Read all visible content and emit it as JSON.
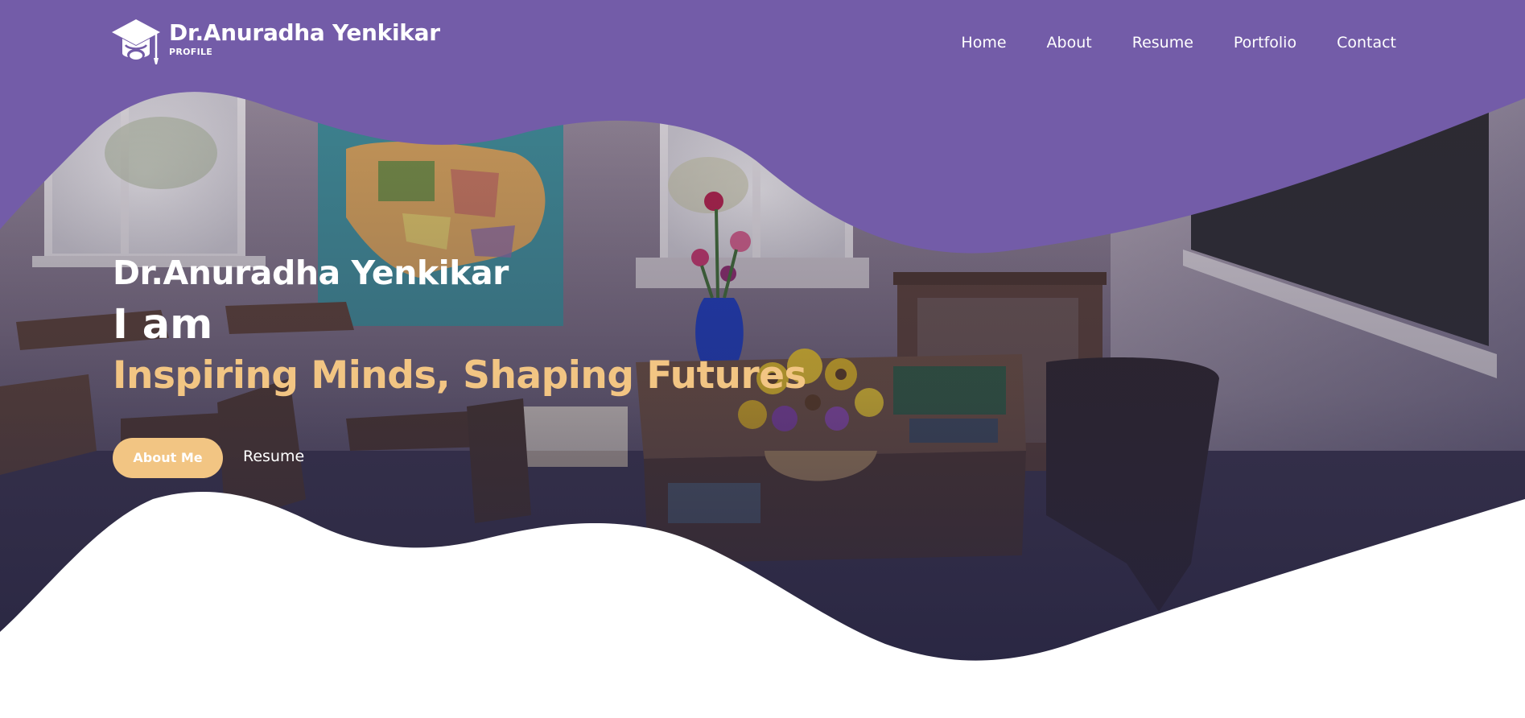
{
  "colors": {
    "header_bg": "#735ca8",
    "accent": "#f2c583",
    "text": "#ffffff"
  },
  "brand": {
    "icon": "graduation-cap-icon",
    "title": "Dr.Anuradha Yenkikar",
    "subtitle": "PROFILE"
  },
  "nav": {
    "items": [
      {
        "label": "Home"
      },
      {
        "label": "About"
      },
      {
        "label": "Resume"
      },
      {
        "label": "Portfolio"
      },
      {
        "label": "Contact"
      }
    ]
  },
  "hero": {
    "name": "Dr.Anuradha Yenkikar",
    "intro": "I am",
    "tagline": "Inspiring Minds, Shaping Futures",
    "background": "classroom-photo",
    "primary_button": "About Me",
    "secondary_link": "Resume"
  }
}
